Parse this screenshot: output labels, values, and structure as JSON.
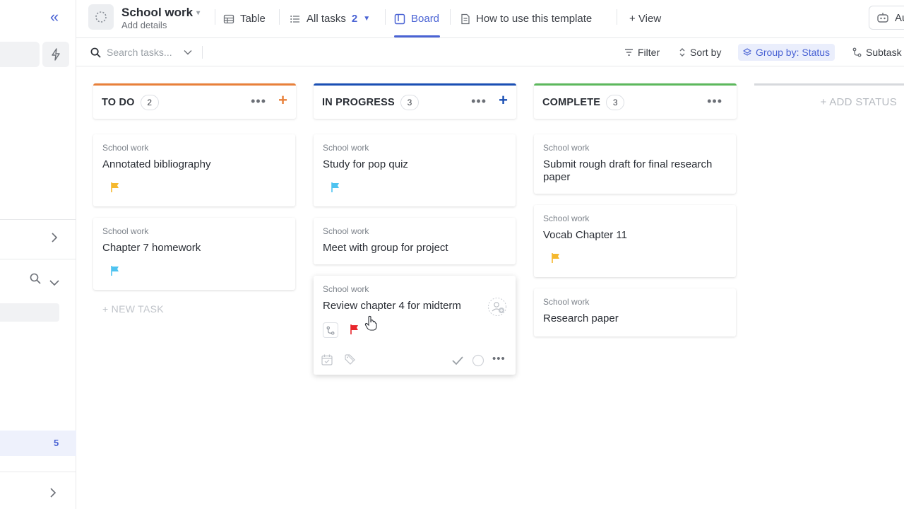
{
  "header": {
    "space_title": "School work",
    "space_subtitle": "Add details",
    "tabs": [
      {
        "label": "Table"
      },
      {
        "label": "All tasks",
        "count": "2"
      },
      {
        "label": "Board"
      },
      {
        "label": "How to use this template"
      },
      {
        "label": "+ View"
      }
    ],
    "automation_label": "Au"
  },
  "toolbar": {
    "search_placeholder": "Search tasks...",
    "filter": "Filter",
    "sort": "Sort by",
    "group": "Group by: Status",
    "subtasks": "Subtask"
  },
  "sidebar": {
    "count": "5"
  },
  "board": {
    "columns": [
      {
        "name": "TO DO",
        "count": "2",
        "color": "#e8803a"
      },
      {
        "name": "IN PROGRESS",
        "count": "3",
        "color": "#1a4fb4"
      },
      {
        "name": "COMPLETE",
        "count": "3",
        "color": "#5cb85c"
      }
    ],
    "add_status": "+ ADD STATUS",
    "new_task": "+ NEW TASK",
    "cards": {
      "todo": [
        {
          "list": "School work",
          "title": "Annotated bibliography",
          "flag": "#f5b82e"
        },
        {
          "list": "School work",
          "title": "Chapter 7 homework",
          "flag": "#4ec3f0"
        }
      ],
      "inprogress": [
        {
          "list": "School work",
          "title": "Study for pop quiz",
          "flag": "#4ec3f0"
        },
        {
          "list": "School work",
          "title": "Meet with group for project"
        },
        {
          "list": "School work",
          "title": "Review chapter 4 for midterm",
          "flag": "#e8262c"
        }
      ],
      "complete": [
        {
          "list": "School work",
          "title": "Submit rough draft for final research paper"
        },
        {
          "list": "School work",
          "title": "Vocab Chapter 11",
          "flag": "#f5b82e"
        },
        {
          "list": "School work",
          "title": "Research paper"
        }
      ]
    }
  }
}
